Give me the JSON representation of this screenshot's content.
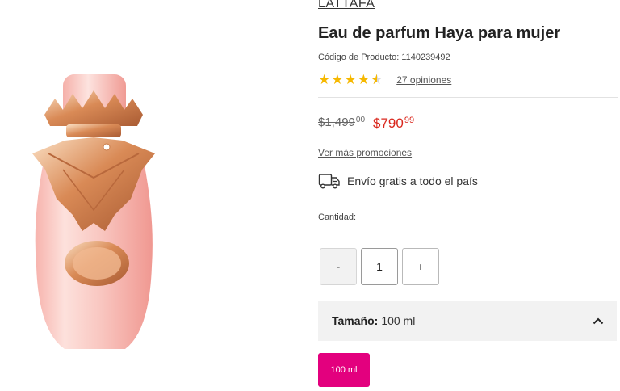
{
  "product": {
    "brand": "LATTAFA",
    "title": "Eau de parfum Haya para mujer",
    "code_label": "Código de Producto:",
    "code": "1140239492",
    "rating": 4.5,
    "reviews": "27 opiniones",
    "image_icon": "perfume-bottle-image"
  },
  "price": {
    "old_whole": "$1,499",
    "old_cents": "00",
    "new_whole": "$790",
    "new_cents": "99"
  },
  "promo": {
    "link": "Ver más promociones"
  },
  "shipping": {
    "icon": "truck-icon",
    "text": "Envío gratis a todo el país"
  },
  "quantity": {
    "label": "Cantidad:",
    "minus": "-",
    "value": "1",
    "plus": "+"
  },
  "size": {
    "label": "Tamaño:",
    "value": "100 ml",
    "option": "100 ml"
  },
  "colors": {
    "price_red": "#d9261c",
    "accent_pink": "#e3007e",
    "star": "#f6b800"
  }
}
